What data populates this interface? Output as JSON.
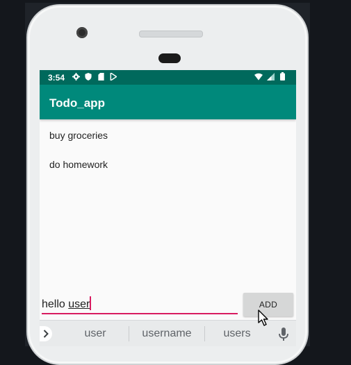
{
  "status_bar": {
    "time": "3:54",
    "left_icons": [
      "gear-icon",
      "shield-icon",
      "sd-card-icon",
      "play-store-icon"
    ],
    "right_icons": [
      "wifi-icon",
      "cell-signal-icon",
      "battery-icon"
    ]
  },
  "app_bar": {
    "title": "Todo_app"
  },
  "todos": [
    {
      "label": "buy groceries"
    },
    {
      "label": "do homework"
    }
  ],
  "input": {
    "prefix": "hello ",
    "composing": "user"
  },
  "add_button": {
    "label": "ADD"
  },
  "suggestions": [
    {
      "label": "user"
    },
    {
      "label": "username"
    },
    {
      "label": "users"
    }
  ],
  "colors": {
    "status_bar": "#00695c",
    "app_bar": "#00897b",
    "accent": "#d81b60"
  }
}
